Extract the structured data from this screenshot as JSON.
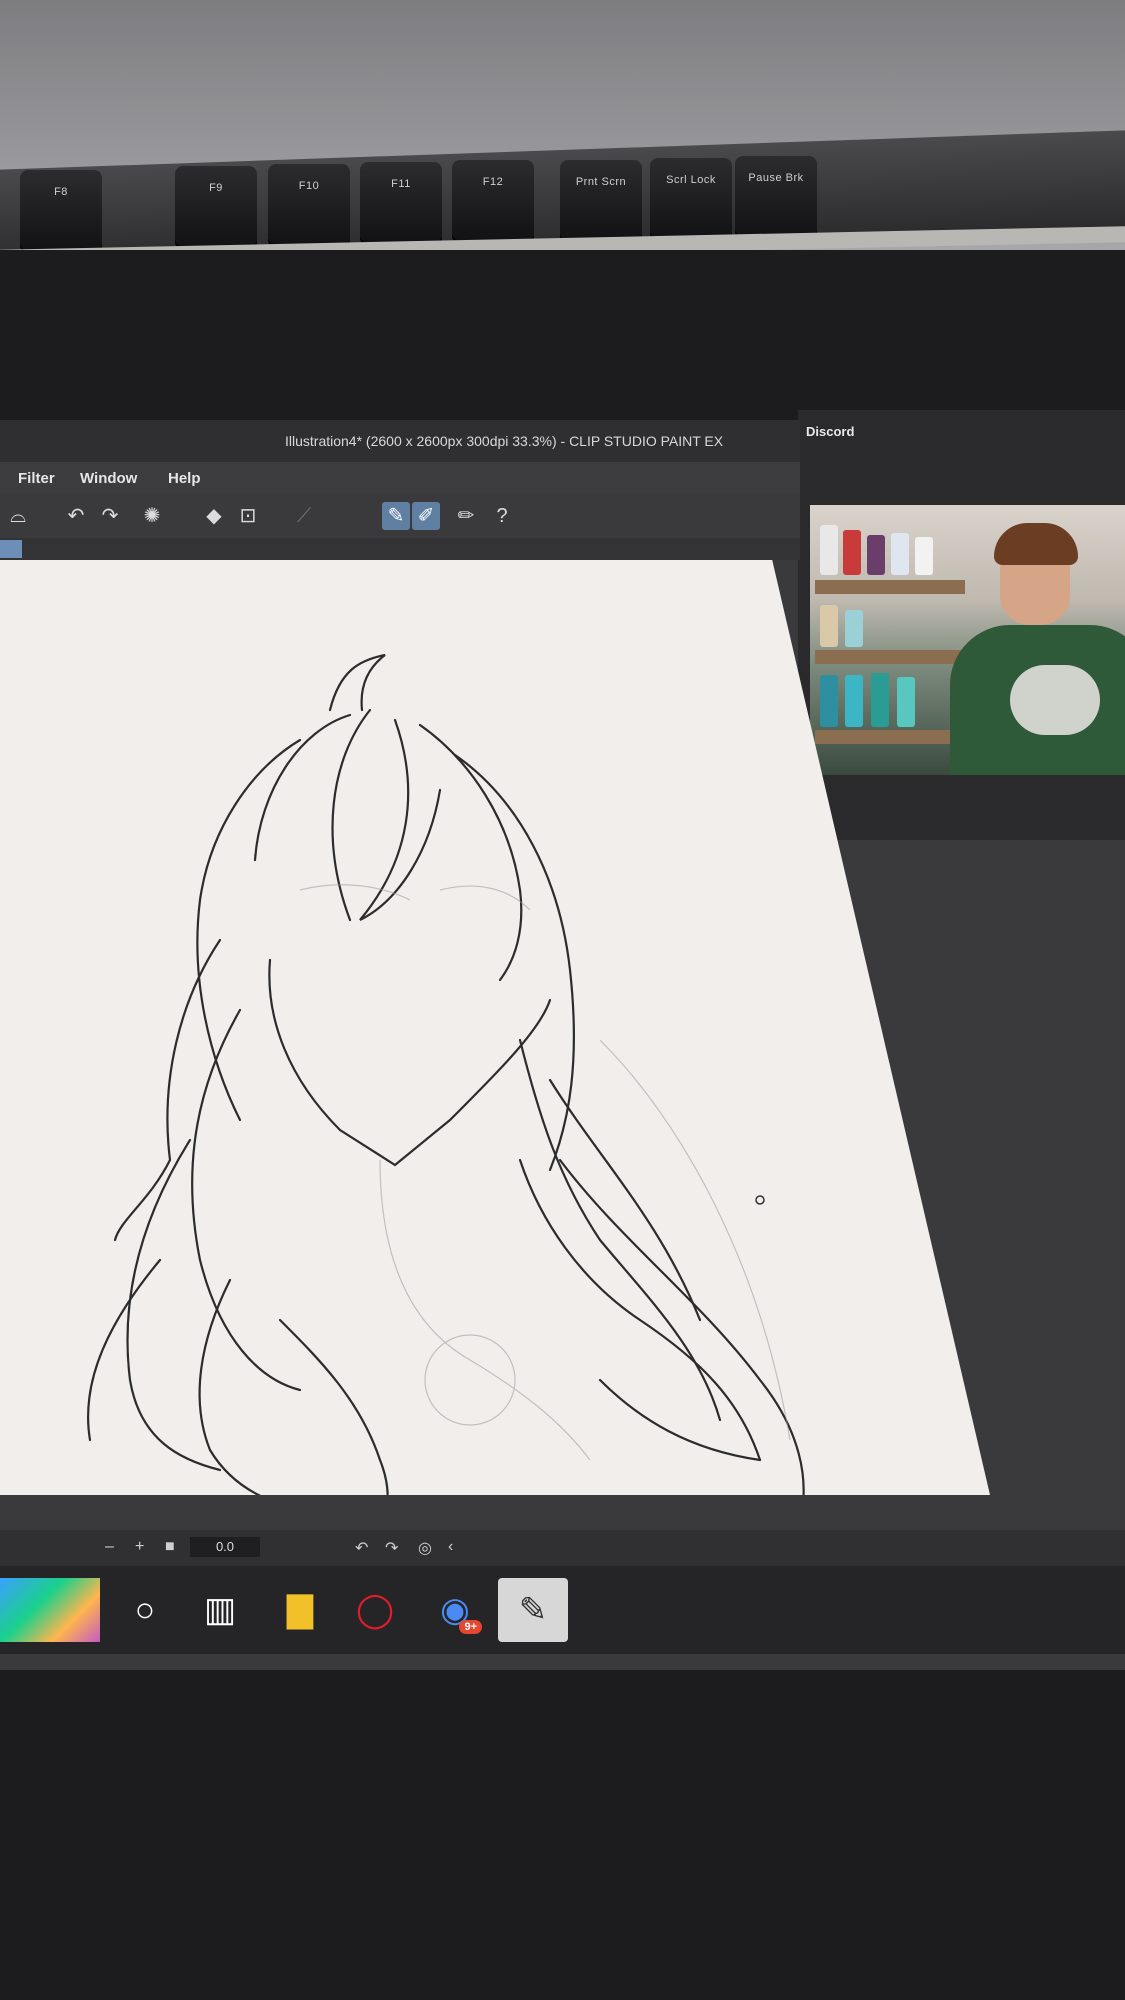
{
  "keyboard": {
    "keys": [
      "F8",
      "F9",
      "F10",
      "F11",
      "F12",
      "Prnt Scrn",
      "Scrl Lock",
      "Pause Brk"
    ]
  },
  "window": {
    "title": "Illustration4* (2600 x 2600px 300dpi 33.3%) - CLIP STUDIO PAINT EX"
  },
  "menu": {
    "items": [
      "Filter",
      "Window",
      "Help"
    ]
  },
  "toolbar": {
    "icons": [
      "lasso-icon",
      "undo-icon",
      "redo-icon",
      "settings-icon",
      "fill-icon",
      "transform-icon",
      "pen-icon",
      "pen-active-icon",
      "help-icon"
    ]
  },
  "discord": {
    "title": "Discord"
  },
  "status": {
    "zoom_value": "0.0",
    "minus": "–",
    "plus": "+"
  },
  "taskbar": {
    "apps": [
      {
        "name": "wallpaper-thumbnail"
      },
      {
        "name": "cortana"
      },
      {
        "name": "task-view"
      },
      {
        "name": "file-explorer"
      },
      {
        "name": "opera"
      },
      {
        "name": "chrome",
        "badge": "9+"
      },
      {
        "name": "clip-studio-paint"
      }
    ]
  },
  "colors": {
    "canvas": "#f1eeec",
    "ui_dark": "#3a3a3d",
    "accent": "#5f7fa3",
    "opera_red": "#e21c2a"
  }
}
